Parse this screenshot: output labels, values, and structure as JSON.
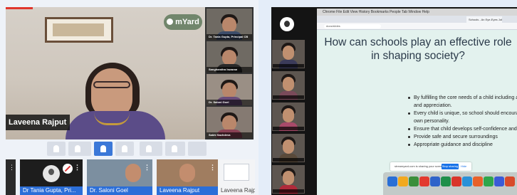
{
  "left": {
    "logo_text": "mYard",
    "main_speaker": "Laveena Rajput",
    "side_tiles": [
      {
        "label": "Dr. Tania Gupta, Principal CB",
        "shirt": "#3d4d6a"
      },
      {
        "label": "Sanghamitra Iswaran",
        "shirt": "#2a2a2a"
      },
      {
        "label": "Dr. Saloni Goel",
        "shirt": "#6a4d7a"
      },
      {
        "label": "Sakhi Sachdeva",
        "shirt": "#8a4255"
      }
    ],
    "bottom_tiles": {
      "tania": "Dr Tania Gupta, Pri...",
      "saloni": "Dr. Saloni Goel",
      "laveena": "Laveena Rajput",
      "share": "Laveena Rajp"
    }
  },
  "right": {
    "menu_bar": "Chrome  File  Edit  View  History  Bookmarks  People  Tab  Window  Help",
    "tab_title": "Schools - An Eye-Eyes Job",
    "url": "docs/slides",
    "slide": {
      "title": "How can schools play an effective role in shaping society?",
      "bullets": [
        "By fulfilling the core needs of a child including acceptance, approval and appreciation.",
        "Every child is unique, so school should encourage him to develop his own personality.",
        "Ensure that child develops self-confidence and self-esteem",
        "Provide safe and secure surroundings",
        "Appropriate guidance and discipline"
      ]
    },
    "share_bar": {
      "message": "streamyard.com is sharing your screen.",
      "stop_label": "Stop sharing",
      "hide_label": "Hide"
    },
    "dock_colors": [
      "#2a6fd6",
      "#f2a91f",
      "#3b8f3b",
      "#e23a2f",
      "#2f63c9",
      "#1f8f4a",
      "#d9352b",
      "#2a91d8",
      "#e8612a",
      "#2fa64b",
      "#3b5bd6",
      "#d84a2a"
    ]
  }
}
